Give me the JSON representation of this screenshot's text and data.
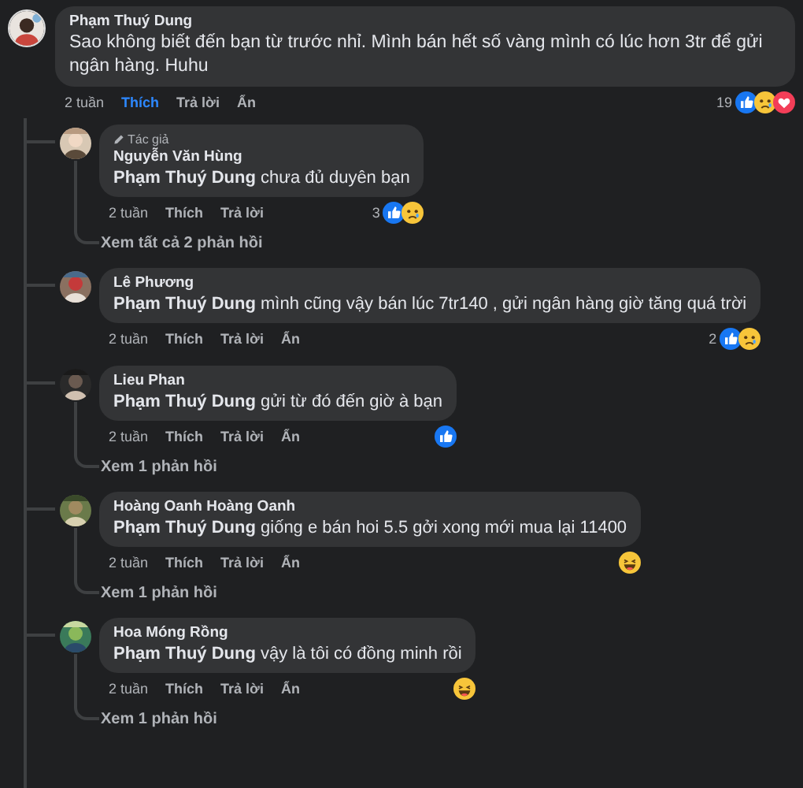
{
  "comment": {
    "author": "Phạm Thuý Dung",
    "text": "Sao không biết đến bạn từ trước nhỉ. Mình bán hết số vàng mình có lúc hơn 3tr để gửi ngân hàng. Huhu",
    "time": "2 tuần",
    "like": {
      "label": "Thích",
      "selected": true
    },
    "reply": "Trả lời",
    "hide": "Ẩn",
    "reaction_count": "19",
    "reactions": [
      {
        "kind": "like"
      },
      {
        "kind": "sad"
      },
      {
        "kind": "love"
      }
    ]
  },
  "replies": [
    {
      "badge": "Tác giả",
      "author": "Nguyễn Văn Hùng",
      "text": "**Phạm Thuý Dung** chưa đủ duyên bạn",
      "time": "2 tuần",
      "like": {
        "label": "Thích",
        "selected": false
      },
      "reply": "Trả lời",
      "reaction_count": "3",
      "reactions": [
        {
          "kind": "like"
        },
        {
          "kind": "sad"
        }
      ],
      "view_replies": "Xem tất cả 2 phản hồi"
    },
    {
      "author": "Lê Phương",
      "text": "**Phạm Thuý Dung** mình cũng vậy bán lúc 7tr140 , gửi ngân hàng giờ tăng quá trời",
      "time": "2 tuần",
      "like": {
        "label": "Thích",
        "selected": false
      },
      "reply": "Trả lời",
      "hide": "Ẩn",
      "reaction_count": "2",
      "reactions": [
        {
          "kind": "like"
        },
        {
          "kind": "sad"
        }
      ]
    },
    {
      "author": "Lieu Phan",
      "text": "**Phạm Thuý Dung** gửi từ đó đến giờ à bạn",
      "time": "2 tuần",
      "like": {
        "label": "Thích",
        "selected": false
      },
      "reply": "Trả lời",
      "hide": "Ẩn",
      "reactions": [
        {
          "kind": "like"
        }
      ],
      "view_replies": "Xem 1 phản hồi"
    },
    {
      "author": "Hoàng Oanh Hoàng Oanh",
      "text": "**Phạm Thuý Dung** giống e bán hoi 5.5 gởi xong mới mua lại 11400",
      "time": "2 tuần",
      "like": {
        "label": "Thích",
        "selected": false
      },
      "reply": "Trả lời",
      "hide": "Ẩn",
      "reactions": [
        {
          "kind": "haha"
        }
      ],
      "view_replies": "Xem 1 phản hồi"
    },
    {
      "author": "Hoa Móng Rồng",
      "text": "**Phạm Thuý Dung** vậy là tôi có đồng minh rồi",
      "time": "2 tuần",
      "like": {
        "label": "Thích",
        "selected": false
      },
      "reply": "Trả lời",
      "hide": "Ẩn",
      "reactions": [
        {
          "kind": "haha"
        }
      ],
      "view_replies": "Xem 1 phản hồi"
    }
  ]
}
